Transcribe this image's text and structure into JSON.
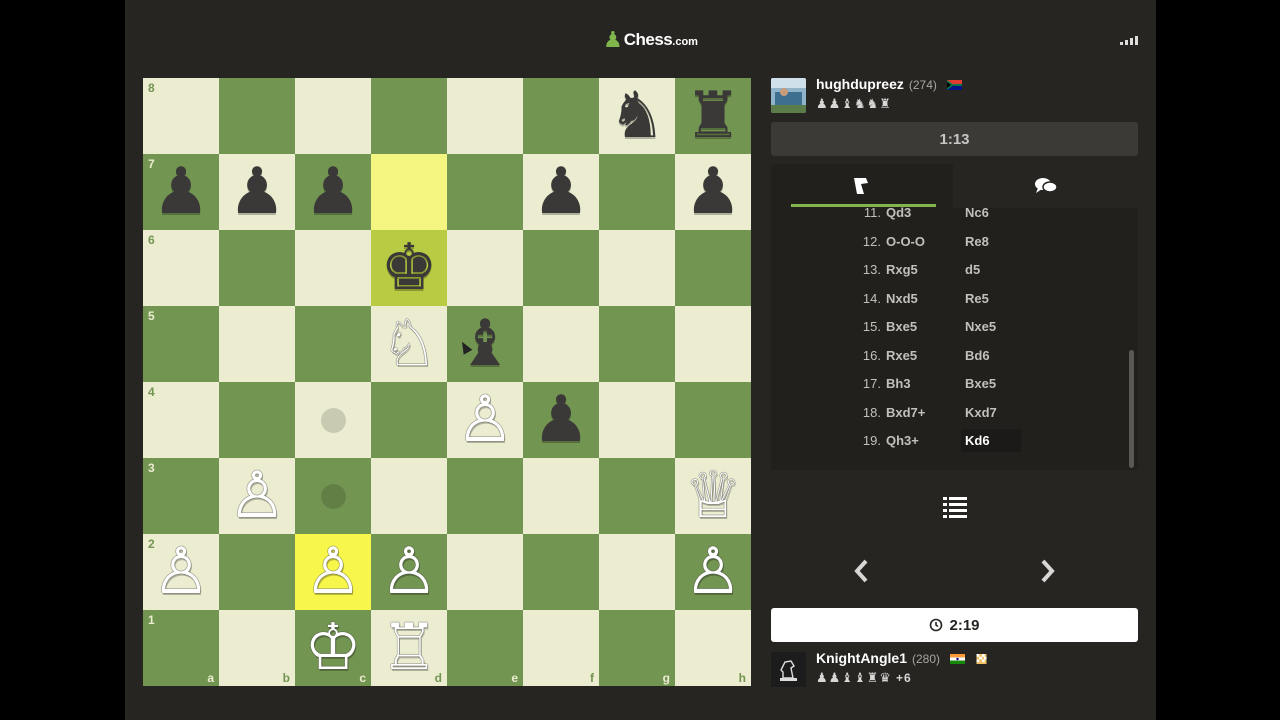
{
  "header": {
    "logo_text": "Chess",
    "logo_suffix": ".com",
    "signal_icon": "signal-bars-icon"
  },
  "colors": {
    "light_square": "#ebecd0",
    "dark_square": "#739552",
    "highlight_light": "#f5f682",
    "highlight_dark": "#b9ca43",
    "accent": "#81b64c",
    "app_bg": "#262522"
  },
  "board": {
    "files": [
      "a",
      "b",
      "c",
      "d",
      "e",
      "f",
      "g",
      "h"
    ],
    "ranks": [
      "8",
      "7",
      "6",
      "5",
      "4",
      "3",
      "2",
      "1"
    ],
    "pieces": [
      {
        "square": "g8",
        "piece": "♞",
        "color": "b",
        "name": "black-knight"
      },
      {
        "square": "h8",
        "piece": "♜",
        "color": "b",
        "name": "black-rook"
      },
      {
        "square": "a7",
        "piece": "♟",
        "color": "b",
        "name": "black-pawn"
      },
      {
        "square": "b7",
        "piece": "♟",
        "color": "b",
        "name": "black-pawn"
      },
      {
        "square": "c7",
        "piece": "♟",
        "color": "b",
        "name": "black-pawn"
      },
      {
        "square": "f7",
        "piece": "♟",
        "color": "b",
        "name": "black-pawn"
      },
      {
        "square": "h7",
        "piece": "♟",
        "color": "b",
        "name": "black-pawn"
      },
      {
        "square": "d6",
        "piece": "♚",
        "color": "b",
        "name": "black-king"
      },
      {
        "square": "d5",
        "piece": "♘",
        "color": "w",
        "name": "white-knight"
      },
      {
        "square": "e5",
        "piece": "♝",
        "color": "b",
        "name": "black-bishop"
      },
      {
        "square": "e4",
        "piece": "♙",
        "color": "w",
        "name": "white-pawn"
      },
      {
        "square": "f4",
        "piece": "♟",
        "color": "b",
        "name": "black-pawn"
      },
      {
        "square": "b3",
        "piece": "♙",
        "color": "w",
        "name": "white-pawn"
      },
      {
        "square": "h3",
        "piece": "♕",
        "color": "w",
        "name": "white-queen"
      },
      {
        "square": "a2",
        "piece": "♙",
        "color": "w",
        "name": "white-pawn"
      },
      {
        "square": "c2",
        "piece": "♙",
        "color": "w",
        "name": "white-pawn"
      },
      {
        "square": "d2",
        "piece": "♙",
        "color": "w",
        "name": "white-pawn"
      },
      {
        "square": "h2",
        "piece": "♙",
        "color": "w",
        "name": "white-pawn"
      },
      {
        "square": "c1",
        "piece": "♔",
        "color": "w",
        "name": "white-king"
      },
      {
        "square": "d1",
        "piece": "♖",
        "color": "w",
        "name": "white-rook"
      }
    ],
    "highlights": {
      "d7": "hl-light",
      "d6": "hl-dark",
      "c2": "hl-strong"
    },
    "move_hints": [
      "c4",
      "c3"
    ]
  },
  "player_top": {
    "name": "hughdupreez",
    "rating": "(274)",
    "captured": "♟♟♝♞♞♜",
    "clock": "1:13"
  },
  "moves": {
    "tab_moves_icon": "moves-tab-icon",
    "tab_chat_icon": "chat-icon",
    "rows": [
      {
        "num": "11.",
        "white": "Qd3",
        "black": "Nc6"
      },
      {
        "num": "12.",
        "white": "O-O-O",
        "black": "Re8"
      },
      {
        "num": "13.",
        "white": "Rxg5",
        "black": "d5"
      },
      {
        "num": "14.",
        "white": "Nxd5",
        "black": "Re5"
      },
      {
        "num": "15.",
        "white": "Bxe5",
        "black": "Nxe5"
      },
      {
        "num": "16.",
        "white": "Rxe5",
        "black": "Bd6"
      },
      {
        "num": "17.",
        "white": "Bh3",
        "black": "Bxe5"
      },
      {
        "num": "18.",
        "white": "Bxd7+",
        "black": "Kxd7"
      },
      {
        "num": "19.",
        "white": "Qh3+",
        "black": "Kd6"
      }
    ]
  },
  "controls": {
    "list_icon": "list-icon",
    "prev_icon": "chevron-left-icon",
    "next_icon": "chevron-right-icon"
  },
  "player_bottom": {
    "name": "KnightAngle1",
    "rating": "(280)",
    "captured": "♟♟♝♝♜♛",
    "advantage": "+6",
    "clock": "2:19",
    "clock_icon": "clock-icon"
  }
}
